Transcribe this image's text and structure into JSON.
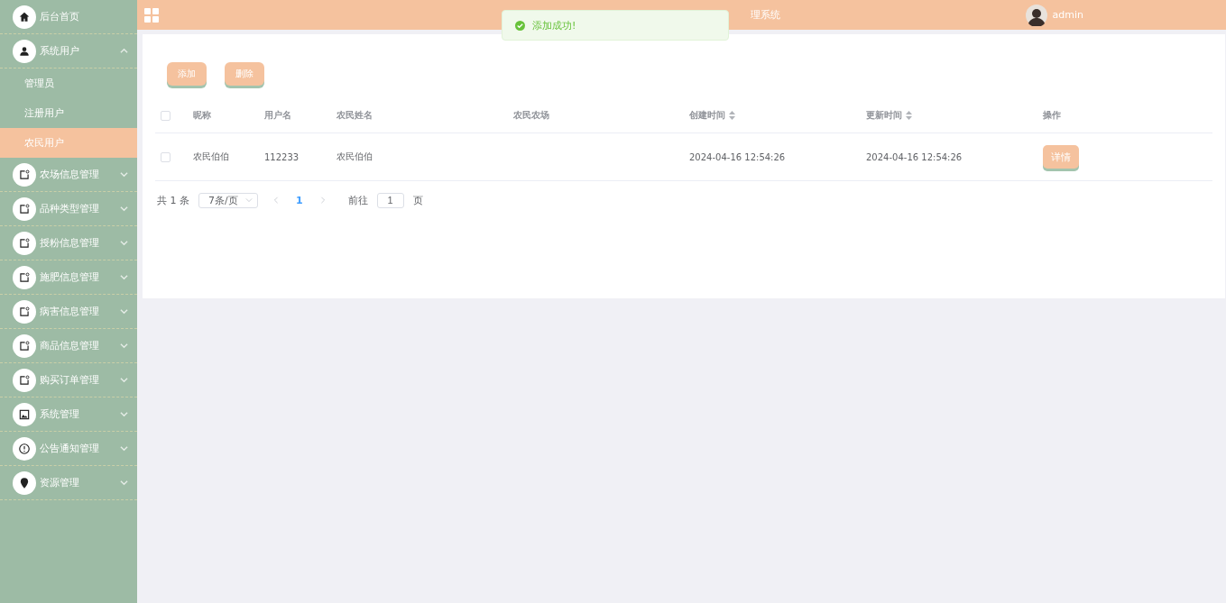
{
  "header": {
    "title_fragment": "理系统",
    "user": "admin"
  },
  "toast": {
    "message": "添加成功!"
  },
  "sidebar": {
    "items": [
      {
        "label": "后台首页"
      },
      {
        "label": "系统用户",
        "expanded": true,
        "children": [
          {
            "label": "管理员",
            "selected": false
          },
          {
            "label": "注册用户",
            "selected": false
          },
          {
            "label": "农民用户",
            "selected": true
          }
        ]
      },
      {
        "label": "农场信息管理",
        "expanded": false
      },
      {
        "label": "品种类型管理",
        "expanded": false
      },
      {
        "label": "授粉信息管理",
        "expanded": false
      },
      {
        "label": "施肥信息管理",
        "expanded": false
      },
      {
        "label": "病害信息管理",
        "expanded": false
      },
      {
        "label": "商品信息管理",
        "expanded": false
      },
      {
        "label": "购买订单管理",
        "expanded": false
      },
      {
        "label": "系统管理",
        "expanded": false
      },
      {
        "label": "公告通知管理",
        "expanded": false
      },
      {
        "label": "资源管理",
        "expanded": false
      }
    ]
  },
  "toolbar": {
    "buttons": [
      "添加",
      "删除"
    ]
  },
  "table": {
    "select_all": {
      "checked": false
    },
    "columns": [
      {
        "label": "昵称",
        "sortable": false
      },
      {
        "label": "用户名",
        "sortable": false
      },
      {
        "label": "农民姓名",
        "sortable": false
      },
      {
        "label": "农民农场",
        "sortable": false
      },
      {
        "label": "创建时间",
        "sortable": true
      },
      {
        "label": "更新时间",
        "sortable": true
      },
      {
        "label": "操作",
        "sortable": false
      }
    ],
    "rows": [
      {
        "checked": false,
        "cells": [
          "农民伯伯",
          "112233",
          "农民伯伯",
          "",
          "2024-04-16 12:54:26",
          "2024-04-16 12:54:26"
        ],
        "action": "详情"
      }
    ]
  },
  "pagination": {
    "total": "共 1 条",
    "page_size": "7条/页",
    "pages": [
      {
        "label": "1",
        "selected": true
      }
    ],
    "goto_label": "前往",
    "goto_value": "1",
    "goto_suffix": "页"
  }
}
